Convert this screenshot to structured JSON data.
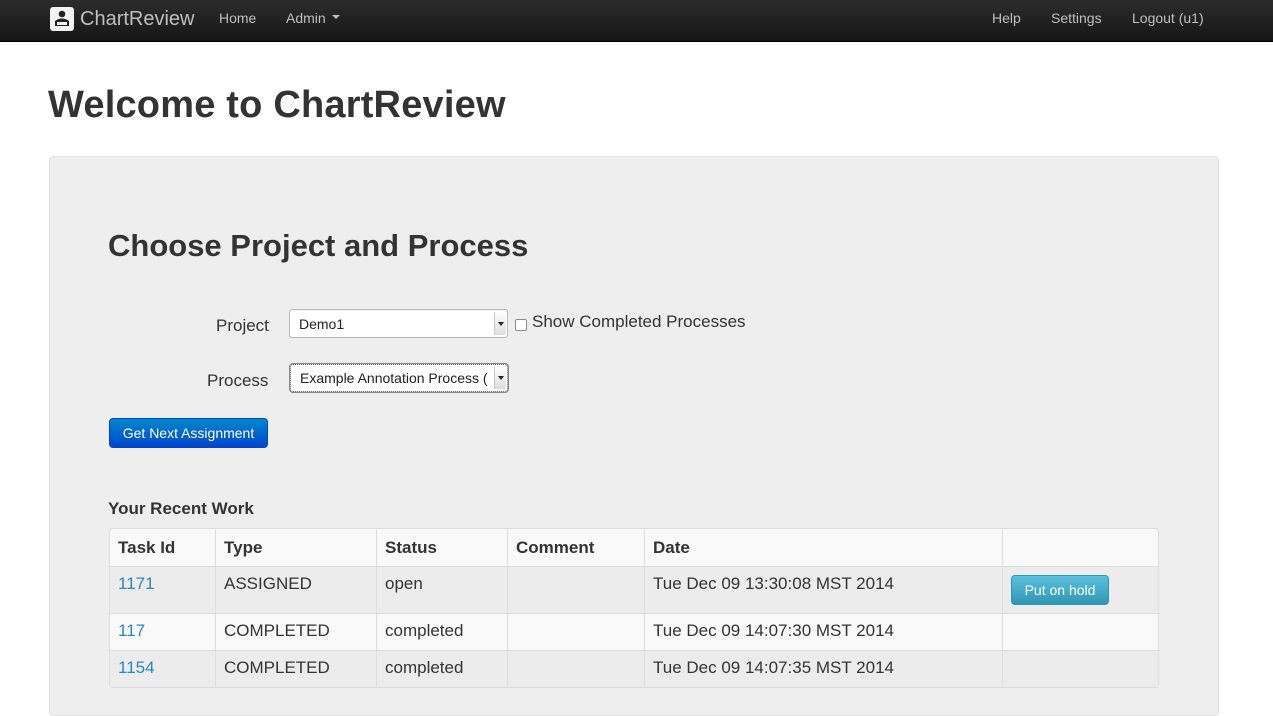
{
  "navbar": {
    "brand": "ChartReview",
    "home": "Home",
    "admin": "Admin",
    "help": "Help",
    "settings": "Settings",
    "logout": "Logout (u1)"
  },
  "page_title": "Welcome to ChartReview",
  "section_title": "Choose Project and Process",
  "form": {
    "project_label": "Project",
    "project_value": "Demo1",
    "show_completed_label": "Show Completed Processes",
    "show_completed_checked": false,
    "process_label": "Process",
    "process_value": "Example Annotation Process (",
    "get_next_label": "Get Next Assignment"
  },
  "recent_work": {
    "title": "Your Recent Work",
    "columns": [
      "Task Id",
      "Type",
      "Status",
      "Comment",
      "Date",
      ""
    ],
    "rows": [
      {
        "task_id": "1171",
        "type": "ASSIGNED",
        "status": "open",
        "comment": "",
        "date": "Tue Dec 09 13:30:08 MST 2014",
        "action": "Put on hold"
      },
      {
        "task_id": "117",
        "type": "COMPLETED",
        "status": "completed",
        "comment": "",
        "date": "Tue Dec 09 14:07:30 MST 2014",
        "action": ""
      },
      {
        "task_id": "1154",
        "type": "COMPLETED",
        "status": "completed",
        "comment": "",
        "date": "Tue Dec 09 14:07:35 MST 2014",
        "action": ""
      }
    ]
  },
  "colors": {
    "primary": "#0066cc",
    "info": "#49afcd",
    "link": "#2a86c4",
    "navbar": "#1b1b1b"
  }
}
